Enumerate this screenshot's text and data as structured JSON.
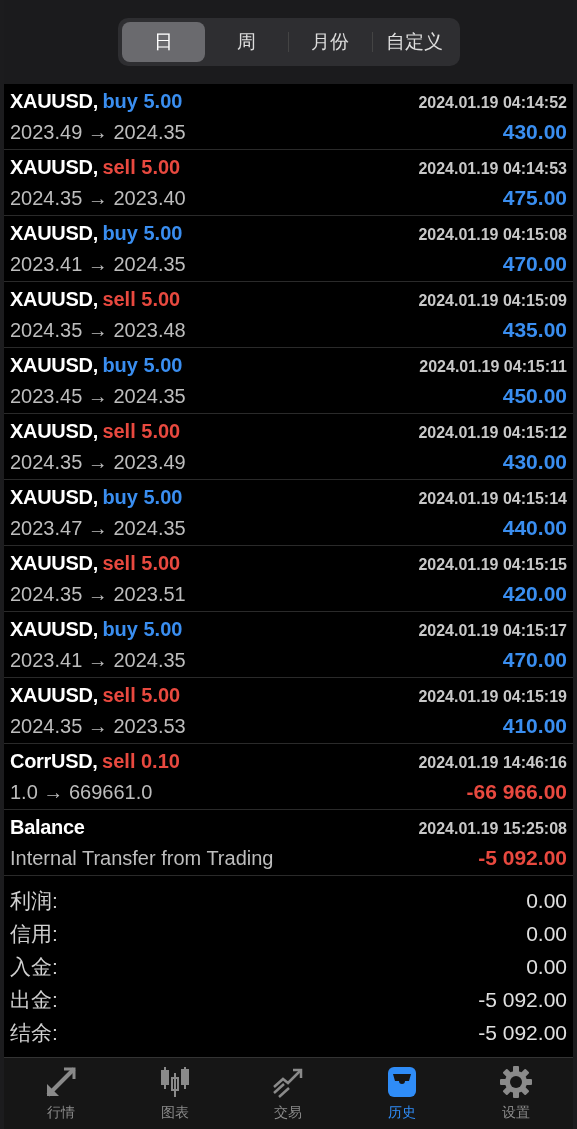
{
  "period_tabs": [
    {
      "label": "日",
      "selected": true
    },
    {
      "label": "周",
      "selected": false
    },
    {
      "label": "月份",
      "selected": false
    },
    {
      "label": "自定义",
      "selected": false
    }
  ],
  "deals": [
    {
      "kind": "buy",
      "symbol": "XAUUSD,",
      "action": "buy 5.00",
      "time": "2024.01.19 04:14:52",
      "detail": "2023.49 → 2024.35",
      "profit": "430.00",
      "loss": false
    },
    {
      "kind": "sell",
      "symbol": "XAUUSD,",
      "action": "sell 5.00",
      "time": "2024.01.19 04:14:53",
      "detail": "2024.35 → 2023.40",
      "profit": "475.00",
      "loss": false
    },
    {
      "kind": "buy",
      "symbol": "XAUUSD,",
      "action": "buy 5.00",
      "time": "2024.01.19 04:15:08",
      "detail": "2023.41 → 2024.35",
      "profit": "470.00",
      "loss": false
    },
    {
      "kind": "sell",
      "symbol": "XAUUSD,",
      "action": "sell 5.00",
      "time": "2024.01.19 04:15:09",
      "detail": "2024.35 → 2023.48",
      "profit": "435.00",
      "loss": false
    },
    {
      "kind": "buy",
      "symbol": "XAUUSD,",
      "action": "buy 5.00",
      "time": "2024.01.19 04:15:11",
      "detail": "2023.45 → 2024.35",
      "profit": "450.00",
      "loss": false
    },
    {
      "kind": "sell",
      "symbol": "XAUUSD,",
      "action": "sell 5.00",
      "time": "2024.01.19 04:15:12",
      "detail": "2024.35 → 2023.49",
      "profit": "430.00",
      "loss": false
    },
    {
      "kind": "buy",
      "symbol": "XAUUSD,",
      "action": "buy 5.00",
      "time": "2024.01.19 04:15:14",
      "detail": "2023.47 → 2024.35",
      "profit": "440.00",
      "loss": false
    },
    {
      "kind": "sell",
      "symbol": "XAUUSD,",
      "action": "sell 5.00",
      "time": "2024.01.19 04:15:15",
      "detail": "2024.35 → 2023.51",
      "profit": "420.00",
      "loss": false
    },
    {
      "kind": "buy",
      "symbol": "XAUUSD,",
      "action": "buy 5.00",
      "time": "2024.01.19 04:15:17",
      "detail": "2023.41 → 2024.35",
      "profit": "470.00",
      "loss": false
    },
    {
      "kind": "sell",
      "symbol": "XAUUSD,",
      "action": "sell 5.00",
      "time": "2024.01.19 04:15:19",
      "detail": "2024.35 → 2023.53",
      "profit": "410.00",
      "loss": false
    },
    {
      "kind": "sell",
      "symbol": "CorrUSD,",
      "action": "sell 0.10",
      "time": "2024.01.19 14:46:16",
      "detail": "1.0 → 669661.0",
      "profit": "-66 966.00",
      "loss": true
    },
    {
      "kind": "balance",
      "symbol": "Balance",
      "time": "2024.01.19 15:25:08",
      "detail": "Internal Transfer from Trading",
      "profit": "-5 092.00",
      "loss": true
    }
  ],
  "summary": [
    {
      "label": "利润:",
      "value": "0.00"
    },
    {
      "label": "信用:",
      "value": "0.00"
    },
    {
      "label": "入金:",
      "value": "0.00"
    },
    {
      "label": "出金:",
      "value": "-5 092.00"
    },
    {
      "label": "结余:",
      "value": "-5 092.00"
    }
  ],
  "bottom_nav": [
    {
      "kind": "quotes",
      "label": "行情",
      "selected": false
    },
    {
      "kind": "chart",
      "label": "图表",
      "selected": false
    },
    {
      "kind": "trade",
      "label": "交易",
      "selected": false
    },
    {
      "kind": "history",
      "label": "历史",
      "selected": true
    },
    {
      "kind": "settings",
      "label": "设置",
      "selected": false
    }
  ]
}
